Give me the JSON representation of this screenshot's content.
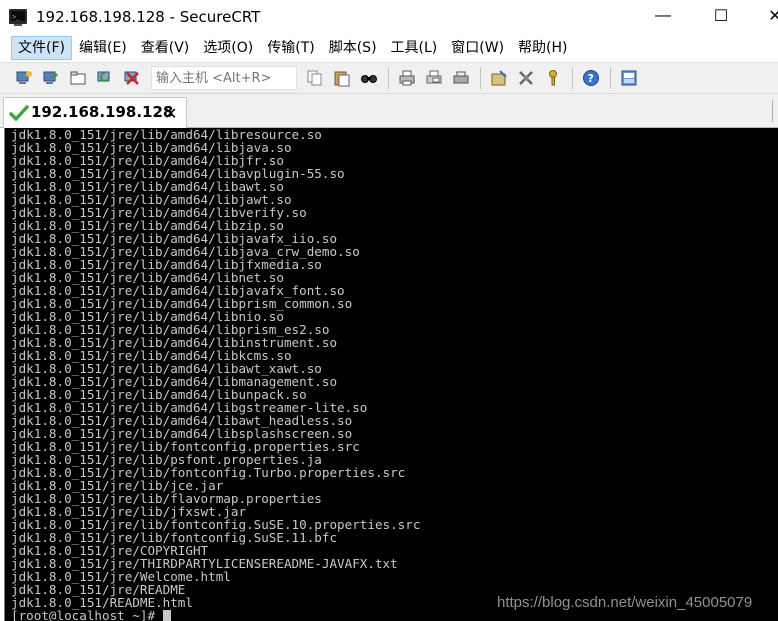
{
  "window": {
    "title": "192.168.198.128 - SecureCRT",
    "minimize_glyph": "—",
    "maximize_glyph": "☐",
    "close_glyph": "✕"
  },
  "menu": {
    "items": [
      {
        "label": "文件(F)",
        "active": true
      },
      {
        "label": "编辑(E)",
        "active": false
      },
      {
        "label": "查看(V)",
        "active": false
      },
      {
        "label": "选项(O)",
        "active": false
      },
      {
        "label": "传输(T)",
        "active": false
      },
      {
        "label": "脚本(S)",
        "active": false
      },
      {
        "label": "工具(L)",
        "active": false
      },
      {
        "label": "窗口(W)",
        "active": false
      },
      {
        "label": "帮助(H)",
        "active": false
      }
    ]
  },
  "toolbar": {
    "host_input_placeholder": "输入主机 <Alt+R>",
    "icons": [
      "connect-icon",
      "quick-connect-icon",
      "connect-in-tab-icon",
      "reconnect-icon",
      "disconnect-icon",
      "copy-icon",
      "paste-icon",
      "find-icon",
      "print-icon",
      "print-screen-icon",
      "printer-icon",
      "session-options-icon",
      "global-options-icon",
      "keymap-icon",
      "help-icon",
      "log-icon"
    ]
  },
  "tab": {
    "label": "192.168.198.128",
    "close_glyph": "✕",
    "status_icon": "checkmark-icon"
  },
  "terminal": {
    "lines": [
      "jdk1.8.0_151/jre/lib/amd64/libresource.so",
      "jdk1.8.0_151/jre/lib/amd64/libjava.so",
      "jdk1.8.0_151/jre/lib/amd64/libjfr.so",
      "jdk1.8.0_151/jre/lib/amd64/libavplugin-55.so",
      "jdk1.8.0_151/jre/lib/amd64/libawt.so",
      "jdk1.8.0_151/jre/lib/amd64/libjawt.so",
      "jdk1.8.0_151/jre/lib/amd64/libverify.so",
      "jdk1.8.0_151/jre/lib/amd64/libzip.so",
      "jdk1.8.0_151/jre/lib/amd64/libjavafx_iio.so",
      "jdk1.8.0_151/jre/lib/amd64/libjava_crw_demo.so",
      "jdk1.8.0_151/jre/lib/amd64/libjfxmedia.so",
      "jdk1.8.0_151/jre/lib/amd64/libnet.so",
      "jdk1.8.0_151/jre/lib/amd64/libjavafx_font.so",
      "jdk1.8.0_151/jre/lib/amd64/libprism_common.so",
      "jdk1.8.0_151/jre/lib/amd64/libnio.so",
      "jdk1.8.0_151/jre/lib/amd64/libprism_es2.so",
      "jdk1.8.0_151/jre/lib/amd64/libinstrument.so",
      "jdk1.8.0_151/jre/lib/amd64/libkcms.so",
      "jdk1.8.0_151/jre/lib/amd64/libawt_xawt.so",
      "jdk1.8.0_151/jre/lib/amd64/libmanagement.so",
      "jdk1.8.0_151/jre/lib/amd64/libunpack.so",
      "jdk1.8.0_151/jre/lib/amd64/libgstreamer-lite.so",
      "jdk1.8.0_151/jre/lib/amd64/libawt_headless.so",
      "jdk1.8.0_151/jre/lib/amd64/libsplashscreen.so",
      "jdk1.8.0_151/jre/lib/fontconfig.properties.src",
      "jdk1.8.0_151/jre/lib/psfont.properties.ja",
      "jdk1.8.0_151/jre/lib/fontconfig.Turbo.properties.src",
      "jdk1.8.0_151/jre/lib/jce.jar",
      "jdk1.8.0_151/jre/lib/flavormap.properties",
      "jdk1.8.0_151/jre/lib/jfxswt.jar",
      "jdk1.8.0_151/jre/lib/fontconfig.SuSE.10.properties.src",
      "jdk1.8.0_151/jre/lib/fontconfig.SuSE.11.bfc",
      "jdk1.8.0_151/jre/COPYRIGHT",
      "jdk1.8.0_151/jre/THIRDPARTYLICENSEREADME-JAVAFX.txt",
      "jdk1.8.0_151/jre/Welcome.html",
      "jdk1.8.0_151/jre/README",
      "jdk1.8.0_151/README.html"
    ],
    "prompt": "[root@localhost ~]# ",
    "watermark": "https://blog.csdn.net/weixin_45005079"
  }
}
